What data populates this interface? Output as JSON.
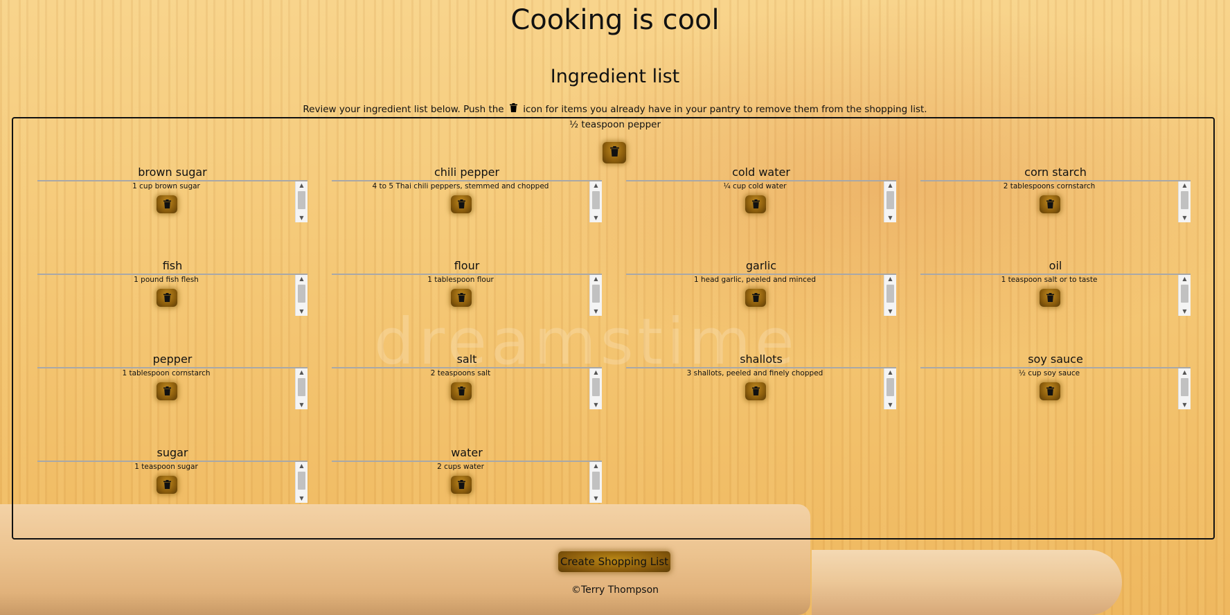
{
  "page": {
    "title": "Cooking is cool",
    "subtitle": "Ingredient list",
    "instructions_before": "Review your ingredient list below. Push the",
    "instructions_after": "icon for items you already have in your pantry to remove them from the shopping list.",
    "instruction_icon": "trash-icon"
  },
  "pantry_item": {
    "text": "½ teaspoon pepper",
    "icon": "trash-icon"
  },
  "ingredients": [
    {
      "name": "brown sugar",
      "detail": "1 cup brown sugar"
    },
    {
      "name": "chili pepper",
      "detail": "4 to 5 Thai chili peppers, stemmed and chopped"
    },
    {
      "name": "cold water",
      "detail": "¼ cup cold water"
    },
    {
      "name": "corn starch",
      "detail": "2 tablespoons cornstarch"
    },
    {
      "name": "fish",
      "detail": "1 pound fish flesh"
    },
    {
      "name": "flour",
      "detail": "1 tablespoon flour"
    },
    {
      "name": "garlic",
      "detail": "1 head garlic, peeled and minced"
    },
    {
      "name": "oil",
      "detail": "1 teaspoon salt or to taste"
    },
    {
      "name": "pepper",
      "detail": "1 tablespoon cornstarch"
    },
    {
      "name": "salt",
      "detail": "2 teaspoons salt"
    },
    {
      "name": "shallots",
      "detail": "3 shallots, peeled and finely chopped"
    },
    {
      "name": "soy sauce",
      "detail": "½ cup soy sauce"
    },
    {
      "name": "sugar",
      "detail": "1 teaspoon sugar"
    },
    {
      "name": "water",
      "detail": "2 cups water"
    }
  ],
  "actions": {
    "create_label": "Create Shopping List"
  },
  "footer": {
    "text": "©Terry Thompson"
  },
  "watermark": "dreamstime",
  "colors": {
    "button": "#8a5c0c",
    "border": "#111111",
    "background": "#f5c978"
  }
}
